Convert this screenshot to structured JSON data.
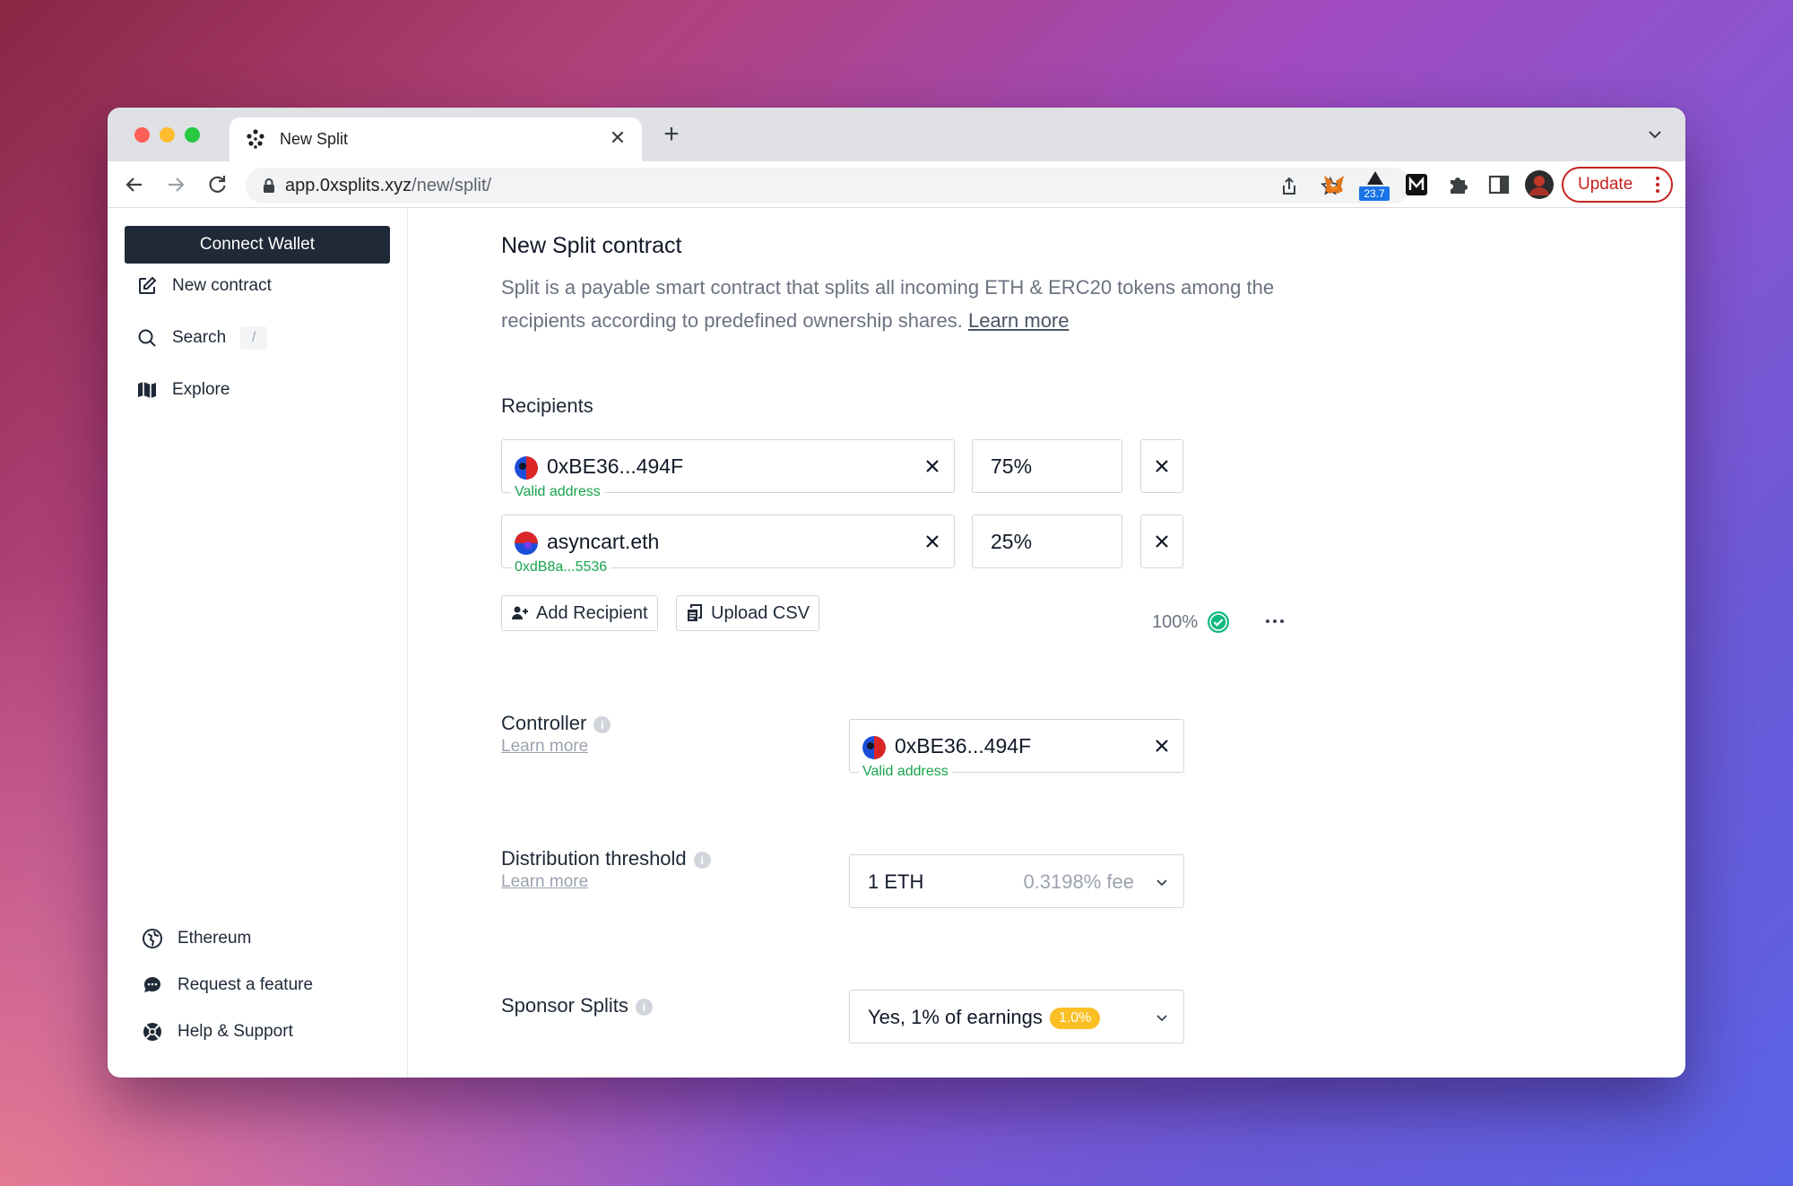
{
  "browser": {
    "tab_title": "New Split",
    "url_host": "app.0xsplits.xyz",
    "url_path": "/new/split/",
    "extension_badge": "23.7",
    "update_label": "Update"
  },
  "sidebar": {
    "connect_label": "Connect Wallet",
    "items": [
      {
        "label": "New contract",
        "icon": "edit-icon"
      },
      {
        "label": "Search",
        "icon": "search-icon",
        "shortcut": "/"
      },
      {
        "label": "Explore",
        "icon": "map-icon"
      }
    ],
    "bottom_items": [
      {
        "label": "Ethereum",
        "icon": "globe-icon"
      },
      {
        "label": "Request a feature",
        "icon": "chat-icon"
      },
      {
        "label": "Help & Support",
        "icon": "lifebuoy-icon"
      }
    ]
  },
  "main": {
    "title": "New Split contract",
    "description": "Split is a payable smart contract that splits all incoming ETH & ERC20 tokens among the recipients according to predefined ownership shares.",
    "description_link": "Learn more",
    "recipients_label": "Recipients",
    "recipients": [
      {
        "address": "0xBE36...494F",
        "hint": "Valid address",
        "percent": "75%"
      },
      {
        "address": "asyncart.eth",
        "hint": "0xdB8a...5536",
        "percent": "25%"
      }
    ],
    "add_recipient_label": "Add Recipient",
    "upload_csv_label": "Upload CSV",
    "total_percent": "100%",
    "controller": {
      "label": "Controller",
      "learn_more": "Learn more",
      "address": "0xBE36...494F",
      "hint": "Valid address"
    },
    "threshold": {
      "label": "Distribution threshold",
      "learn_more": "Learn more",
      "value": "1 ETH",
      "fee": "0.3198% fee"
    },
    "sponsor": {
      "label": "Sponsor Splits",
      "value": "Yes, 1% of earnings",
      "badge": "1.0%"
    }
  },
  "colors": {
    "accent_green": "#16a34a",
    "badge_yellow": "#fbbf24",
    "connect_bg": "#1f2937",
    "update_red": "#c5221f"
  }
}
